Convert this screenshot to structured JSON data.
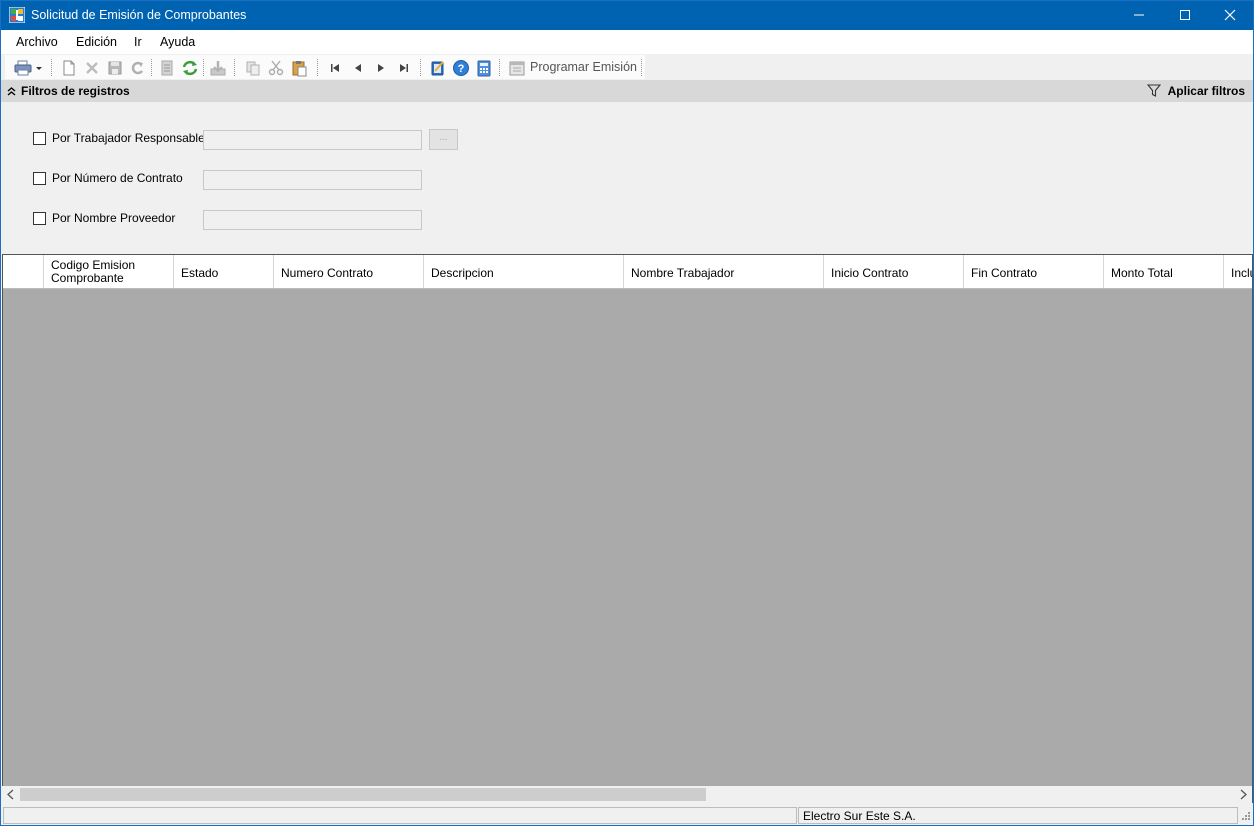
{
  "window": {
    "title": "Solicitud de Emisión de Comprobantes",
    "title_bar_color": "#0063b1"
  },
  "menu": {
    "items": [
      "Archivo",
      "Edición",
      "Ir",
      "Ayuda"
    ]
  },
  "toolbar": {
    "icons": [
      "print-icon",
      "new-document-icon",
      "delete-icon",
      "save-icon",
      "undo-icon",
      "print-preview-icon",
      "refresh-icon",
      "export-icon",
      "copy-icon",
      "cut-icon",
      "paste-icon",
      "first-record-icon",
      "previous-record-icon",
      "next-record-icon",
      "last-record-icon",
      "edit-document-icon",
      "help-icon",
      "calculator-icon",
      "calendar-icon"
    ],
    "program_label": "Programar Emisión"
  },
  "filter_panel": {
    "title": "Filtros de registros",
    "apply_label": "Aplicar filtros",
    "filters": [
      {
        "label": "Por Trabajador Responsable",
        "value": "",
        "checked": false
      },
      {
        "label": "Por Número de Contrato",
        "value": "",
        "checked": false
      },
      {
        "label": "Por Nombre Proveedor",
        "value": "",
        "checked": false
      }
    ],
    "lookup_button": "..."
  },
  "grid": {
    "columns": [
      "Codigo Emision Comprobante",
      "Estado",
      "Numero Contrato",
      "Descripcion",
      "Nombre Trabajador",
      "Inicio Contrato",
      "Fin Contrato",
      "Monto Total",
      "Inclu"
    ],
    "rows": [],
    "background_color": "#aaaaaa"
  },
  "statusbar": {
    "left": "",
    "company": "Electro Sur Este S.A."
  }
}
